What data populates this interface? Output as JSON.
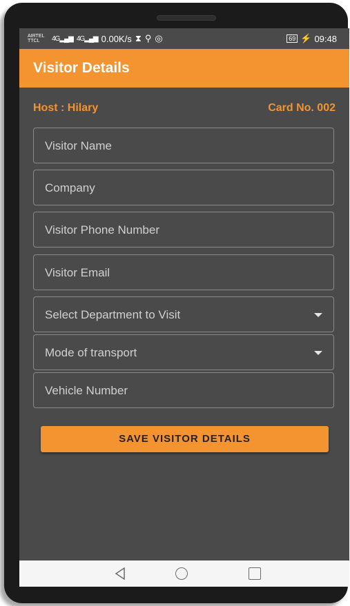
{
  "status": {
    "carrier": "AIRTEL TTCL",
    "network_a": "4G",
    "network_b": "4G",
    "speed": "0.00K/s",
    "battery": "69",
    "time": "09:48"
  },
  "appbar": {
    "title": "Visitor Details"
  },
  "info": {
    "host": "Host : Hilary",
    "card": "Card No. 002"
  },
  "form": {
    "visitor_name_placeholder": "Visitor Name",
    "company_placeholder": "Company",
    "phone_placeholder": "Visitor Phone Number",
    "email_placeholder": "Visitor Email",
    "department_placeholder": "Select Department to Visit",
    "transport_placeholder": "Mode of transport",
    "vehicle_placeholder": "Vehicle Number"
  },
  "buttons": {
    "save_label": "SAVE VISITOR DETAILS"
  },
  "colors": {
    "accent": "#f39430",
    "background": "#4a4a4a",
    "navbar": "#f5f5f5"
  },
  "nav": {
    "back_icon": "back-triangle-icon",
    "home_icon": "home-circle-icon",
    "recent_icon": "recents-square-icon"
  }
}
